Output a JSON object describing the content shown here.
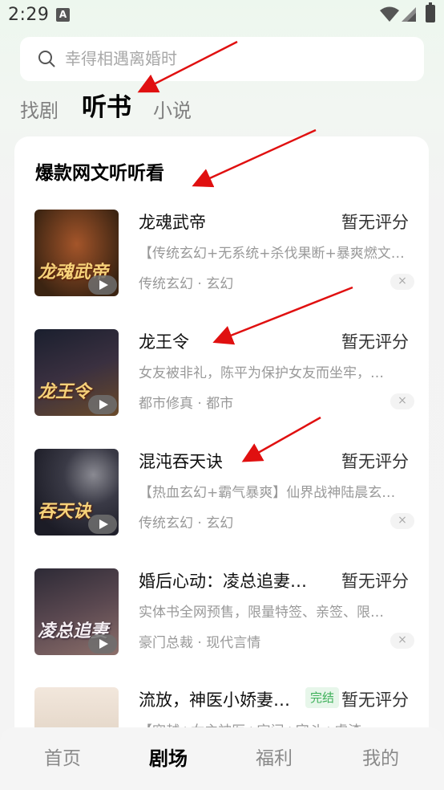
{
  "status_bar": {
    "time": "2:29",
    "notification_icon": "a-letter-icon"
  },
  "search": {
    "placeholder": "幸得相遇离婚时"
  },
  "tabs": [
    {
      "label": "找剧",
      "active": false
    },
    {
      "label": "听书",
      "active": true
    },
    {
      "label": "小说",
      "active": false
    }
  ],
  "section": {
    "title": "爆款网文听听看"
  },
  "books": [
    {
      "title": "龙魂武帝",
      "rating": "暂无评分",
      "description": "【传统玄幻+无系统+杀伐果断+暴爽燃文…",
      "tags": "传统玄幻 · 玄幻",
      "cover_text": "龙魂武帝",
      "cover_colors": [
        "#3b2412",
        "#a4552a"
      ]
    },
    {
      "title": "龙王令",
      "rating": "暂无评分",
      "description": "女友被非礼，陈平为保护女友而坐牢，…",
      "tags": "都市修真 · 都市",
      "cover_text": "龙王令",
      "cover_colors": [
        "#1a1f2e",
        "#6a4a2a"
      ]
    },
    {
      "title": "混沌吞天诀",
      "rating": "暂无评分",
      "description": "【热血玄幻+霸气暴爽】仙界战神陆晨玄…",
      "tags": "传统玄幻 · 玄幻",
      "cover_text": "吞天诀",
      "cover_colors": [
        "#1c1c26",
        "#57575f"
      ]
    },
    {
      "title": "婚后心动：凌总追妻有…",
      "rating": "暂无评分",
      "description": "实体书全网预售，限量特签、亲签、限…",
      "tags": "豪门总裁 · 现代言情",
      "cover_text": "凌总追妻",
      "cover_colors": [
        "#2d2a36",
        "#8c6f6a"
      ]
    },
    {
      "title": "流放，神医小娇妻…",
      "rating": "暂无评分",
      "badge": "完结",
      "description": "【穿越+女主神医+空间+宅斗+虐渣…",
      "tags": "",
      "cover_text": "",
      "cover_colors": [
        "#d9c9b8",
        "#f2e7dc"
      ]
    }
  ],
  "dismiss_label": "×",
  "bottom_nav": [
    {
      "label": "首页",
      "active": false
    },
    {
      "label": "剧场",
      "active": true
    },
    {
      "label": "福利",
      "active": false
    },
    {
      "label": "我的",
      "active": false
    }
  ],
  "colors": {
    "accent_green": "#3fb15b",
    "annotation_red": "#e01010"
  }
}
